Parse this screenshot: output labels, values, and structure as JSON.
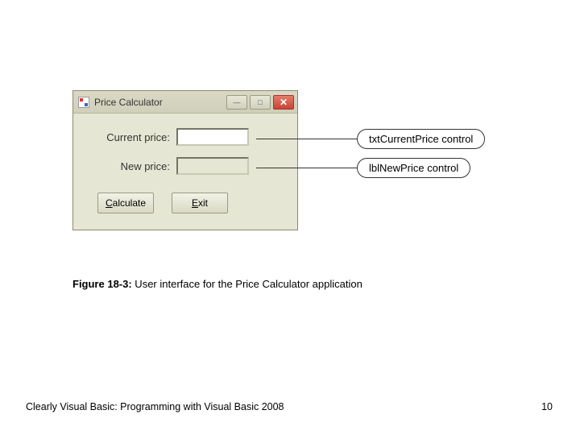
{
  "window": {
    "title": "Price Calculator",
    "labels": {
      "current_price": "Current price:",
      "new_price": "New price:"
    },
    "buttons": {
      "calculate_prefix": "C",
      "calculate_rest": "alculate",
      "exit_prefix": "E",
      "exit_rest": "xit"
    }
  },
  "callouts": {
    "c1": "txtCurrentPrice control",
    "c2": "lblNewPrice control"
  },
  "figure": {
    "label": "Figure 18-3:",
    "text": " User interface for the Price Calculator application"
  },
  "footer": {
    "left": "Clearly Visual Basic: Programming with Visual Basic 2008",
    "right": "10"
  }
}
